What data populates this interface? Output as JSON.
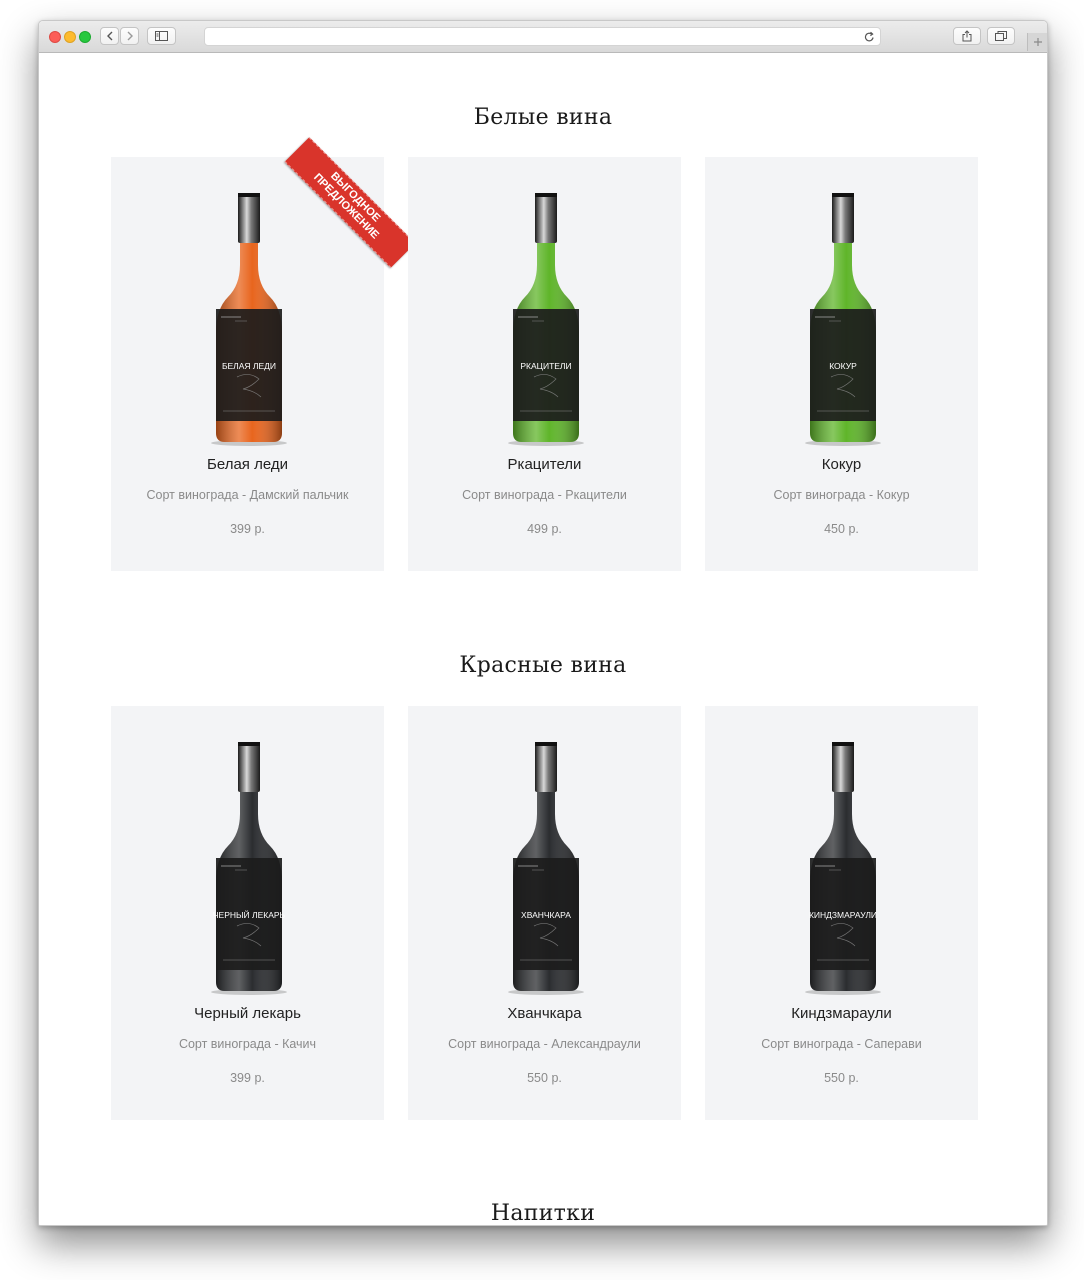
{
  "browser": {
    "address": ""
  },
  "sections": [
    {
      "title": "Белые вина",
      "products": [
        {
          "name": "Белая леди",
          "grape": "Сорт винограда - Дамский пальчик",
          "price": "399 р.",
          "label": "БЕЛАЯ ЛЕДИ",
          "glass": "#e8651e",
          "badge": "ВЫГОДНОЕ ПРЕДЛОЖЕНИЕ"
        },
        {
          "name": "Ркацители",
          "grape": "Сорт винограда - Ркацители",
          "price": "499 р.",
          "label": "РКАЦИТЕЛИ",
          "glass": "#5fb52a"
        },
        {
          "name": "Кокур",
          "grape": "Сорт винограда - Кокур",
          "price": "450 р.",
          "label": "КОКУР",
          "glass": "#5fb52a"
        }
      ]
    },
    {
      "title": "Красные вина",
      "products": [
        {
          "name": "Черный лекарь",
          "grape": "Сорт винограда - Качич",
          "price": "399 р.",
          "label": "ЧЕРНЫЙ ЛЕКАРЬ",
          "glass": "#2b2d30"
        },
        {
          "name": "Хванчкара",
          "grape": "Сорт винограда - Александраули",
          "price": "550 р.",
          "label": "ХВАНЧКАРА",
          "glass": "#2b2d30"
        },
        {
          "name": "Киндзмараули",
          "grape": "Сорт винограда - Саперави",
          "price": "550 р.",
          "label": "КИНДЗМАРАУЛИ",
          "glass": "#2b2d30"
        }
      ]
    },
    {
      "title": "Напитки",
      "products": []
    }
  ],
  "colors": {
    "card_background": "#f3f4f6",
    "badge": "#d9342b"
  }
}
